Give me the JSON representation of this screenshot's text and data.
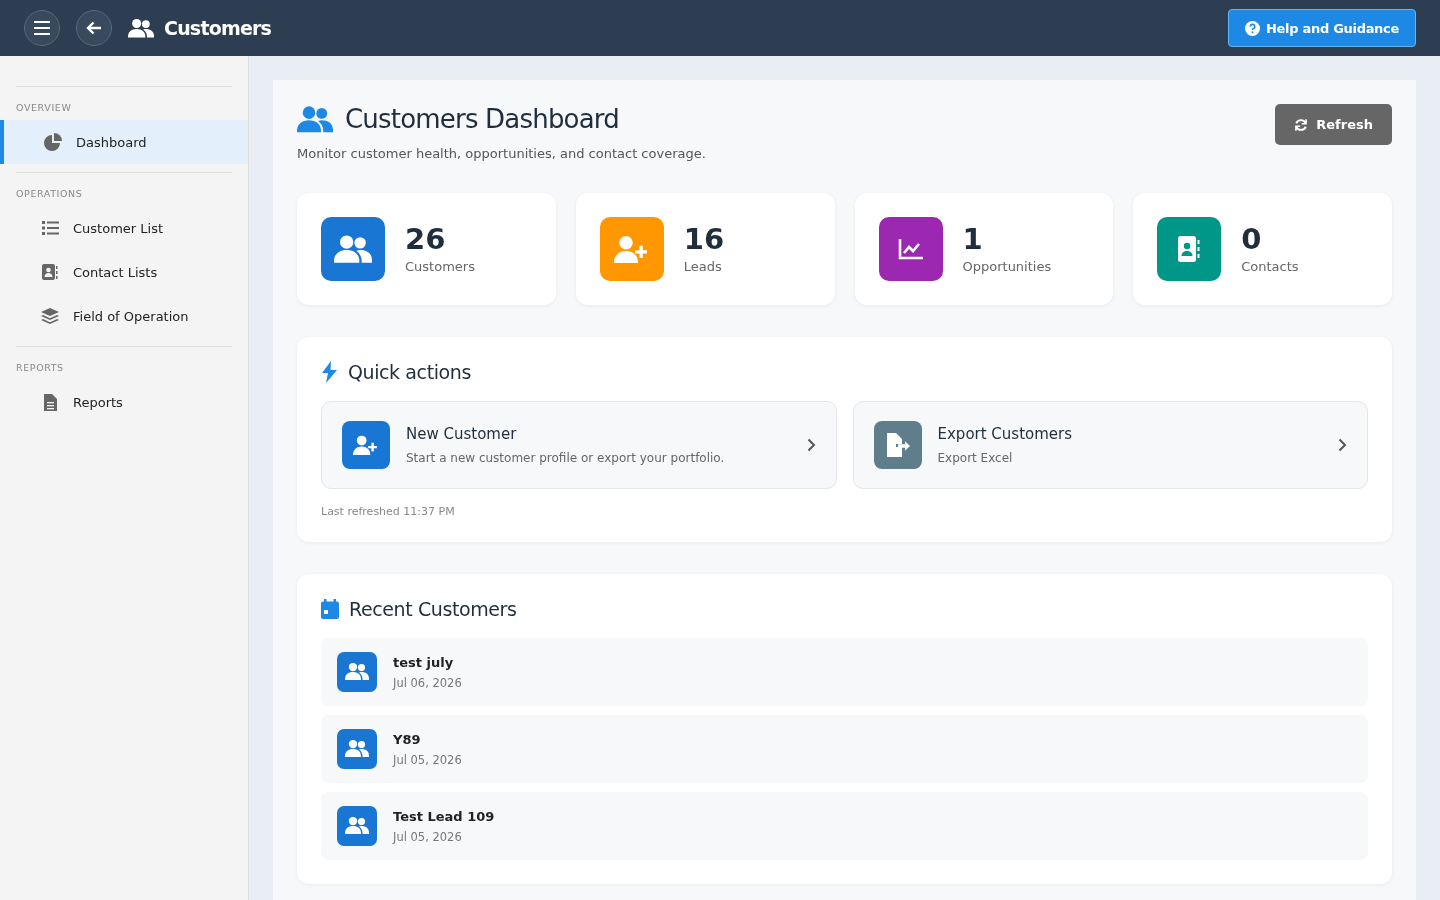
{
  "topbar": {
    "title": "Customers",
    "help_button": "Help and Guidance"
  },
  "sidebar": {
    "sections": [
      {
        "heading": "OVERVIEW",
        "items": [
          {
            "label": "Dashboard",
            "selected": true
          }
        ]
      },
      {
        "heading": "OPERATIONS",
        "items": [
          {
            "label": "Customer List",
            "selected": false
          },
          {
            "label": "Contact Lists",
            "selected": false
          },
          {
            "label": "Field of Operation",
            "selected": false
          }
        ]
      },
      {
        "heading": "REPORTS",
        "items": [
          {
            "label": "Reports",
            "selected": false
          }
        ]
      }
    ]
  },
  "page": {
    "title": "Customers Dashboard",
    "subtitle": "Monitor customer health, opportunities, and contact coverage.",
    "refresh_button": "Refresh"
  },
  "stats": [
    {
      "value": "26",
      "label": "Customers",
      "color": "#1976d2"
    },
    {
      "value": "16",
      "label": "Leads",
      "color": "#ff9800"
    },
    {
      "value": "1",
      "label": "Opportunities",
      "color": "#9c27b0"
    },
    {
      "value": "0",
      "label": "Contacts",
      "color": "#009688"
    }
  ],
  "quick_actions": {
    "title": "Quick actions",
    "actions": [
      {
        "title": "New Customer",
        "description": "Start a new customer profile or export your portfolio.",
        "color": "#1976d2"
      },
      {
        "title": "Export Customers",
        "description": "Export Excel",
        "color": "#607d8b"
      }
    ],
    "last_refreshed": "Last refreshed 11:37 PM"
  },
  "recent_customers": {
    "title": "Recent Customers",
    "rows": [
      {
        "name": "test july",
        "date": "Jul 06, 2026"
      },
      {
        "name": "Y89",
        "date": "Jul 05, 2026"
      },
      {
        "name": "Test Lead 109",
        "date": "Jul 05, 2026"
      }
    ]
  }
}
